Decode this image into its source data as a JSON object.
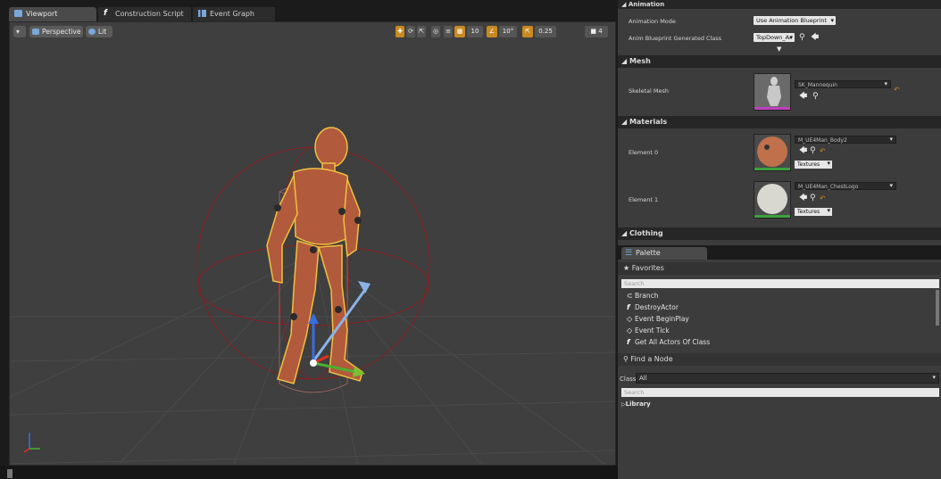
{
  "tabs": [
    {
      "label": "Viewport",
      "icon": "viewport-icon"
    },
    {
      "label": "Construction Script",
      "icon": "function-icon"
    },
    {
      "label": "Event Graph",
      "icon": "graph-icon"
    }
  ],
  "viewport": {
    "menu_label": "",
    "view_mode": "Perspective",
    "lighting_mode": "Lit",
    "toolbar": {
      "grid_snap": "10",
      "rotation_snap": "10°",
      "scale_snap": "0.25",
      "camera_speed": "4"
    }
  },
  "details": {
    "animation": {
      "header": "Animation",
      "mode_label": "Animation Mode",
      "mode_value": "Use Animation Blueprint",
      "class_label": "Anim Blueprint Generated Class",
      "class_value": "TopDown_Ar"
    },
    "mesh": {
      "header": "Mesh",
      "skeletal_label": "Skeletal Mesh",
      "skeletal_value": "SK_Mannequin"
    },
    "materials": {
      "header": "Materials",
      "elements": [
        {
          "label": "Element 0",
          "value": "M_UE4Man_Body2",
          "textures": "Textures"
        },
        {
          "label": "Element 1",
          "value": "M_UE4Man_ChestLogo",
          "textures": "Textures"
        }
      ]
    },
    "clothing": {
      "header": "Clothing"
    }
  },
  "palette": {
    "tab_label": "Palette",
    "favorites_label": "Favorites",
    "search_placeholder": "Search",
    "favorites": [
      {
        "icon": "branch-icon",
        "label": "Branch"
      },
      {
        "icon": "function-icon",
        "label": "DestroyActor"
      },
      {
        "icon": "event-icon",
        "label": "Event BeginPlay"
      },
      {
        "icon": "event-icon",
        "label": "Event Tick"
      },
      {
        "icon": "function-icon",
        "label": "Get All Actors Of Class"
      }
    ],
    "find_node_label": "Find a Node",
    "class_label": "Class",
    "class_value": "All",
    "search2_placeholder": "Search",
    "library_label": "Library"
  },
  "colors": {
    "accent_orange": "#c98a21",
    "selection_outline": "#f0c040",
    "mannequin": "#b25a3c",
    "skeletal_bar": "#c040c0",
    "material_bar": "#3da03d"
  }
}
